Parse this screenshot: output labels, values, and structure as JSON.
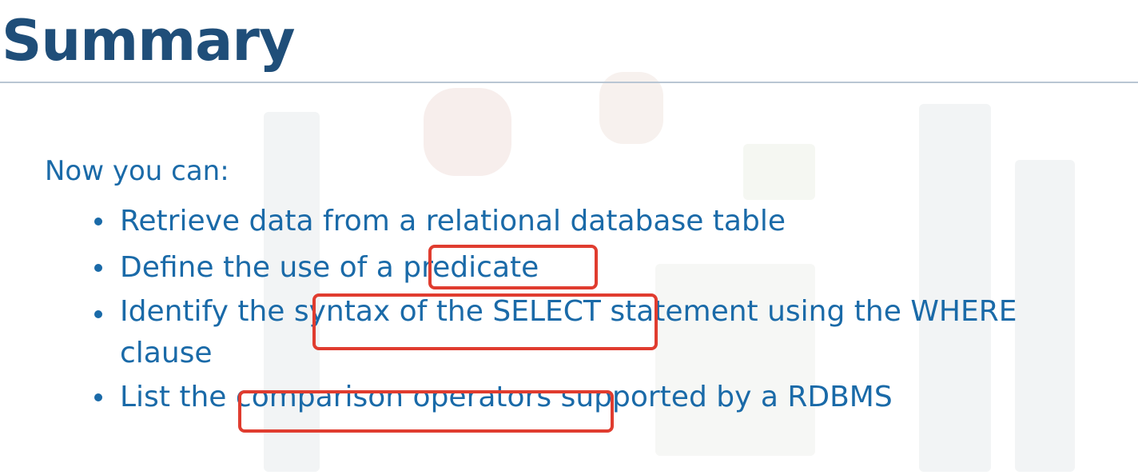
{
  "slide": {
    "title": "Summary",
    "intro": "Now you can:",
    "bullets": [
      {
        "pre": "Retrieve data from a relational database table"
      },
      {
        "pre": "Define the use of a ",
        "highlight": "predicate"
      },
      {
        "pre": "Identify the ",
        "highlight": "syntax of the SELECT",
        "post": " statement using the WHERE",
        "line2": "clause"
      },
      {
        "pre": "List the ",
        "highlight": "comparison operators",
        "post": " supported by a RDBMS"
      }
    ]
  },
  "colors": {
    "title": "#1f4e79",
    "body_text": "#1a6aa8",
    "highlight_box": "#e03c2f",
    "rule": "#b9c6d3"
  },
  "icons": [
    "bullet-dot"
  ]
}
